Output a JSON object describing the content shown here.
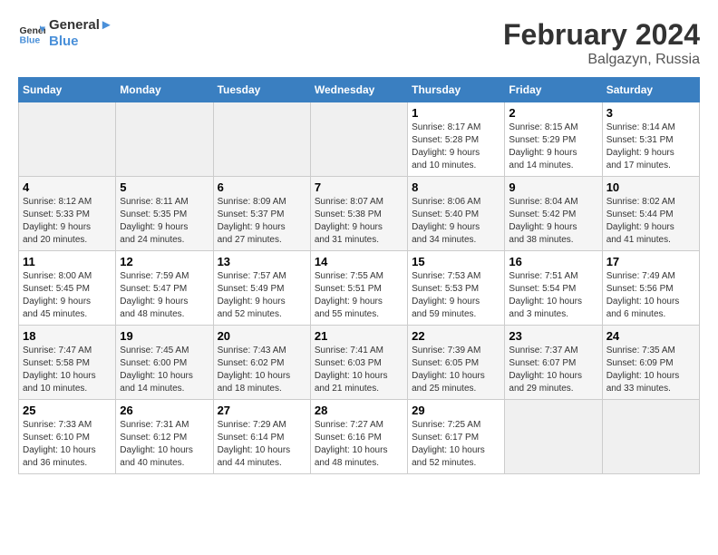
{
  "header": {
    "logo_line1": "General",
    "logo_line2": "Blue",
    "main_title": "February 2024",
    "sub_title": "Balgazyn, Russia"
  },
  "columns": [
    "Sunday",
    "Monday",
    "Tuesday",
    "Wednesday",
    "Thursday",
    "Friday",
    "Saturday"
  ],
  "rows": [
    [
      {
        "day": "",
        "info": ""
      },
      {
        "day": "",
        "info": ""
      },
      {
        "day": "",
        "info": ""
      },
      {
        "day": "",
        "info": ""
      },
      {
        "day": "1",
        "info": "Sunrise: 8:17 AM\nSunset: 5:28 PM\nDaylight: 9 hours\nand 10 minutes."
      },
      {
        "day": "2",
        "info": "Sunrise: 8:15 AM\nSunset: 5:29 PM\nDaylight: 9 hours\nand 14 minutes."
      },
      {
        "day": "3",
        "info": "Sunrise: 8:14 AM\nSunset: 5:31 PM\nDaylight: 9 hours\nand 17 minutes."
      }
    ],
    [
      {
        "day": "4",
        "info": "Sunrise: 8:12 AM\nSunset: 5:33 PM\nDaylight: 9 hours\nand 20 minutes."
      },
      {
        "day": "5",
        "info": "Sunrise: 8:11 AM\nSunset: 5:35 PM\nDaylight: 9 hours\nand 24 minutes."
      },
      {
        "day": "6",
        "info": "Sunrise: 8:09 AM\nSunset: 5:37 PM\nDaylight: 9 hours\nand 27 minutes."
      },
      {
        "day": "7",
        "info": "Sunrise: 8:07 AM\nSunset: 5:38 PM\nDaylight: 9 hours\nand 31 minutes."
      },
      {
        "day": "8",
        "info": "Sunrise: 8:06 AM\nSunset: 5:40 PM\nDaylight: 9 hours\nand 34 minutes."
      },
      {
        "day": "9",
        "info": "Sunrise: 8:04 AM\nSunset: 5:42 PM\nDaylight: 9 hours\nand 38 minutes."
      },
      {
        "day": "10",
        "info": "Sunrise: 8:02 AM\nSunset: 5:44 PM\nDaylight: 9 hours\nand 41 minutes."
      }
    ],
    [
      {
        "day": "11",
        "info": "Sunrise: 8:00 AM\nSunset: 5:45 PM\nDaylight: 9 hours\nand 45 minutes."
      },
      {
        "day": "12",
        "info": "Sunrise: 7:59 AM\nSunset: 5:47 PM\nDaylight: 9 hours\nand 48 minutes."
      },
      {
        "day": "13",
        "info": "Sunrise: 7:57 AM\nSunset: 5:49 PM\nDaylight: 9 hours\nand 52 minutes."
      },
      {
        "day": "14",
        "info": "Sunrise: 7:55 AM\nSunset: 5:51 PM\nDaylight: 9 hours\nand 55 minutes."
      },
      {
        "day": "15",
        "info": "Sunrise: 7:53 AM\nSunset: 5:53 PM\nDaylight: 9 hours\nand 59 minutes."
      },
      {
        "day": "16",
        "info": "Sunrise: 7:51 AM\nSunset: 5:54 PM\nDaylight: 10 hours\nand 3 minutes."
      },
      {
        "day": "17",
        "info": "Sunrise: 7:49 AM\nSunset: 5:56 PM\nDaylight: 10 hours\nand 6 minutes."
      }
    ],
    [
      {
        "day": "18",
        "info": "Sunrise: 7:47 AM\nSunset: 5:58 PM\nDaylight: 10 hours\nand 10 minutes."
      },
      {
        "day": "19",
        "info": "Sunrise: 7:45 AM\nSunset: 6:00 PM\nDaylight: 10 hours\nand 14 minutes."
      },
      {
        "day": "20",
        "info": "Sunrise: 7:43 AM\nSunset: 6:02 PM\nDaylight: 10 hours\nand 18 minutes."
      },
      {
        "day": "21",
        "info": "Sunrise: 7:41 AM\nSunset: 6:03 PM\nDaylight: 10 hours\nand 21 minutes."
      },
      {
        "day": "22",
        "info": "Sunrise: 7:39 AM\nSunset: 6:05 PM\nDaylight: 10 hours\nand 25 minutes."
      },
      {
        "day": "23",
        "info": "Sunrise: 7:37 AM\nSunset: 6:07 PM\nDaylight: 10 hours\nand 29 minutes."
      },
      {
        "day": "24",
        "info": "Sunrise: 7:35 AM\nSunset: 6:09 PM\nDaylight: 10 hours\nand 33 minutes."
      }
    ],
    [
      {
        "day": "25",
        "info": "Sunrise: 7:33 AM\nSunset: 6:10 PM\nDaylight: 10 hours\nand 36 minutes."
      },
      {
        "day": "26",
        "info": "Sunrise: 7:31 AM\nSunset: 6:12 PM\nDaylight: 10 hours\nand 40 minutes."
      },
      {
        "day": "27",
        "info": "Sunrise: 7:29 AM\nSunset: 6:14 PM\nDaylight: 10 hours\nand 44 minutes."
      },
      {
        "day": "28",
        "info": "Sunrise: 7:27 AM\nSunset: 6:16 PM\nDaylight: 10 hours\nand 48 minutes."
      },
      {
        "day": "29",
        "info": "Sunrise: 7:25 AM\nSunset: 6:17 PM\nDaylight: 10 hours\nand 52 minutes."
      },
      {
        "day": "",
        "info": ""
      },
      {
        "day": "",
        "info": ""
      }
    ]
  ]
}
